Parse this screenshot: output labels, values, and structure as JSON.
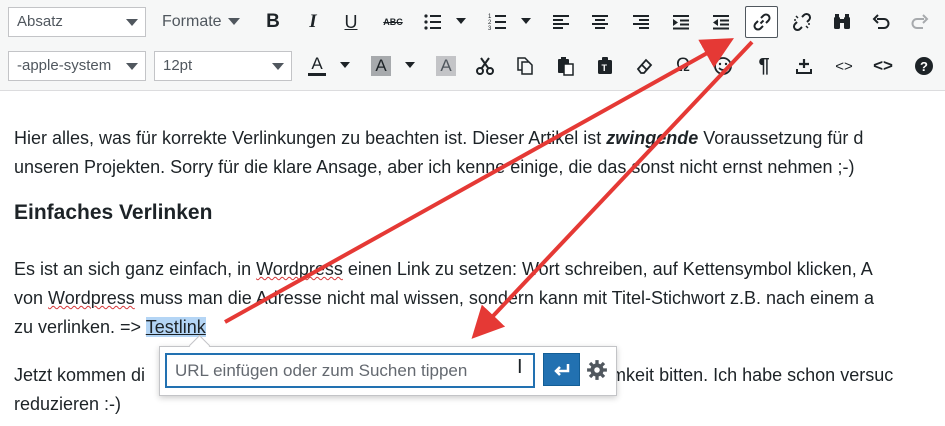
{
  "toolbar": {
    "paragraph_select": "Absatz",
    "formats_menu": "Formate",
    "font_family_select": "-apple-system",
    "font_size_select": "12pt",
    "text_color_glyph": "A",
    "bg_color_glyph": "A",
    "clear_glyph": "A",
    "bold_glyph": "B",
    "italic_glyph": "I",
    "underline_glyph": "U",
    "strike_glyph": "ABC",
    "paragraph_mark_glyph": "¶",
    "omega_glyph": "Ω",
    "help_glyph": "?",
    "code_glyph": "<>",
    "source_glyph": "<>",
    "icons": [
      "bold",
      "italic",
      "underline",
      "strikethrough",
      "bullet-list",
      "numbered-list",
      "align-left",
      "align-center",
      "align-right",
      "indent",
      "outdent",
      "link",
      "unlink",
      "find",
      "undo",
      "redo",
      "cut",
      "copy",
      "paste",
      "paste-text",
      "eraser",
      "special-character",
      "emoji",
      "paragraph-mark",
      "insert",
      "code",
      "source-code",
      "help"
    ]
  },
  "content": {
    "p1_line1_a": "Hier alles, was für korrekte Verlinkungen zu beachten ist. Dieser Artikel ist ",
    "p1_line1_em": "zwingende",
    "p1_line1_b": " Voraussetzung für d",
    "p1_line2": "unseren Projekten. Sorry für die klare Ansage, aber ich kenne einige, die das sonst nicht ernst nehmen ;-)",
    "heading": "Einfaches Verlinken",
    "p2_line1_a": "Es ist an sich ganz einfach, in ",
    "p2_line1_word": "Wordpress",
    "p2_line1_b": " einen Link zu setzen: Wort schreiben, auf Kettensymbol klicken, A",
    "p2_line2_a": "von ",
    "p2_line2_word": "Wordpress",
    "p2_line2_b": " muss man die Adresse nicht mal wissen, sondern kann mit Titel-Stichwort z.B. nach einem a",
    "p2_line3_a": "zu verlinken. => ",
    "p2_line3_link": "Testlink",
    "p3_line1_a": "Jetzt kommen di",
    "p3_line1_b": "samkeit bitten. Ich habe schon versuc",
    "p3_line2": "reduzieren :-)"
  },
  "link_popup": {
    "placeholder": "URL einfügen oder zum Suchen tippen",
    "submit_icon": "return-icon",
    "settings_icon": "gear-icon"
  },
  "colors": {
    "accent": "#2271b1",
    "annotation_arrow": "#e53935",
    "selection": "#b4d5f5"
  }
}
